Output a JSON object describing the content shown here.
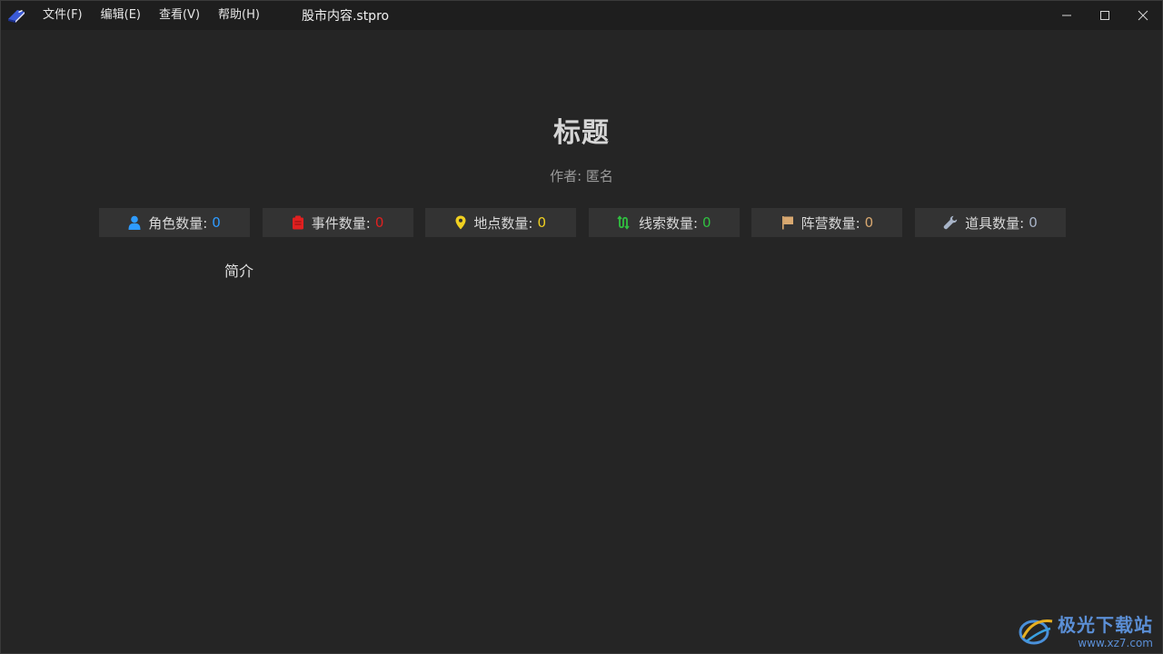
{
  "menu": [
    "文件(F)",
    "编辑(E)",
    "查看(V)",
    "帮助(H)"
  ],
  "window": {
    "doc_title": "股市内容.stpro"
  },
  "main": {
    "title": "标题",
    "author": "作者: 匿名",
    "intro": "简介"
  },
  "stats": [
    {
      "label": "角色数量:",
      "value": "0",
      "icon": "person-icon",
      "color": "#2e9bff"
    },
    {
      "label": "事件数量:",
      "value": "0",
      "icon": "clipboard-icon",
      "color": "#e02020"
    },
    {
      "label": "地点数量:",
      "value": "0",
      "icon": "map-pin-icon",
      "color": "#f0d020"
    },
    {
      "label": "线索数量:",
      "value": "0",
      "icon": "route-icon",
      "color": "#30c040"
    },
    {
      "label": "阵营数量:",
      "value": "0",
      "icon": "flag-icon",
      "color": "#d8a870"
    },
    {
      "label": "道具数量:",
      "value": "0",
      "icon": "wrench-icon",
      "color": "#a8b4c8"
    }
  ],
  "watermark": {
    "text": "极光下载站",
    "url": "www.xz7.com"
  }
}
